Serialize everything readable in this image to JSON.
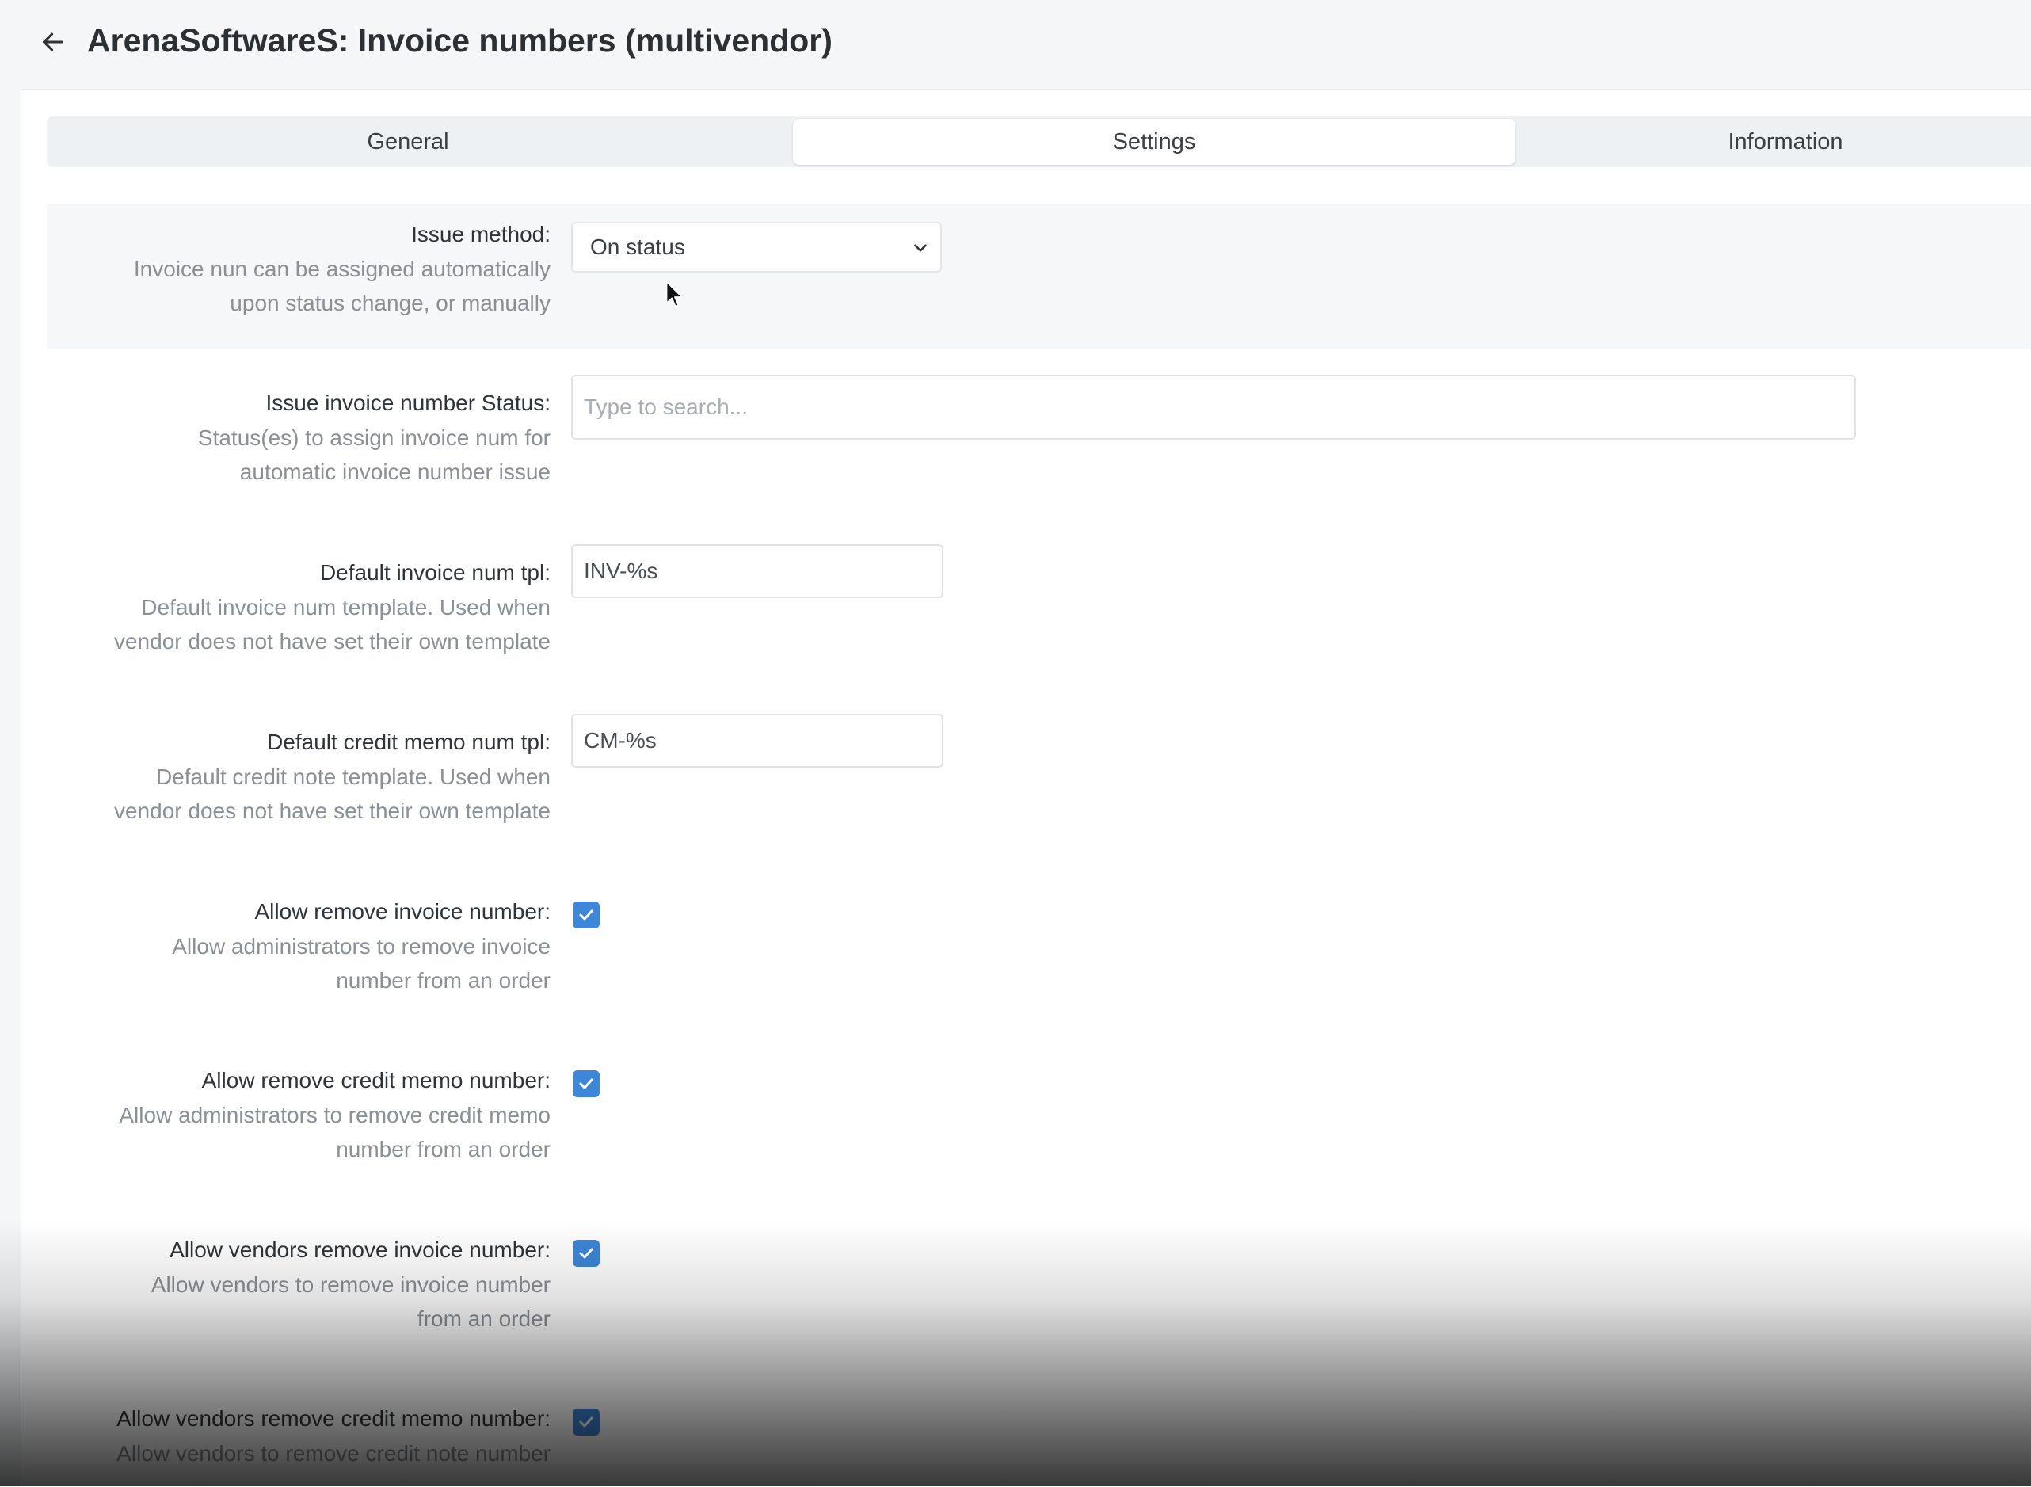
{
  "header": {
    "title": "ArenaSoftwareS: Invoice numbers (multivendor)",
    "back_icon": "arrow-left-icon"
  },
  "tabs": [
    {
      "label": "General",
      "active": false
    },
    {
      "label": "Settings",
      "active": true
    },
    {
      "label": "Information",
      "active": false
    }
  ],
  "settings": {
    "issue_method": {
      "label": "Issue method:",
      "desc1": "Invoice nun can be assigned automatically",
      "desc2": "upon status change, or manually",
      "value": "On status"
    },
    "issue_status": {
      "label": "Issue invoice number Status:",
      "desc1": "Status(es) to assign invoice num for",
      "desc2": "automatic invoice number issue",
      "placeholder": "Type to search..."
    },
    "invoice_tpl": {
      "label": "Default invoice num tpl:",
      "desc1": "Default invoice num template. Used when",
      "desc2": "vendor does not have set their own template",
      "value": "INV-%s"
    },
    "credit_tpl": {
      "label": "Default credit memo num tpl:",
      "desc1": "Default credit note template. Used when",
      "desc2": "vendor does not have set their own template",
      "value": "CM-%s"
    },
    "allow_remove_invoice": {
      "label": "Allow remove invoice number:",
      "desc1": "Allow administrators to remove invoice",
      "desc2": "number from an order",
      "checked": true
    },
    "allow_remove_credit": {
      "label": "Allow remove credit memo number:",
      "desc1": "Allow administrators to remove credit memo",
      "desc2": "number from an order",
      "checked": true
    },
    "allow_vendors_remove_invoice": {
      "label": "Allow vendors remove invoice number:",
      "desc1": "Allow vendors to remove invoice number",
      "desc2": "from an order",
      "checked": true
    },
    "allow_vendors_remove_credit": {
      "label": "Allow vendors remove credit memo number:",
      "desc1": "Allow vendors to remove credit note number",
      "checked": true
    }
  },
  "colors": {
    "accent": "#3d86d8",
    "background": "#f4f6f8",
    "panel": "#ffffff"
  }
}
